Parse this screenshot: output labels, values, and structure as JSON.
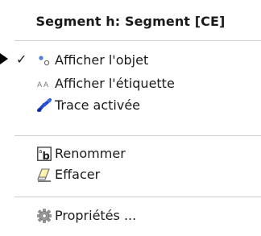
{
  "menu": {
    "title": "Segment h: Segment [CE]",
    "items": [
      {
        "label": "Afficher l'objet",
        "icon": "show-object-icon",
        "checked": true
      },
      {
        "label": "Afficher l'étiquette",
        "icon": "show-label-icon",
        "checked": false
      },
      {
        "label": "Trace activée",
        "icon": "trace-icon",
        "checked": false
      },
      {
        "label": "Renommer",
        "icon": "rename-icon",
        "checked": false
      },
      {
        "label": "Effacer",
        "icon": "eraser-icon",
        "checked": false
      },
      {
        "label": "Propriétés ...",
        "icon": "gear-icon",
        "checked": false
      }
    ],
    "check_glyph": "✓"
  }
}
